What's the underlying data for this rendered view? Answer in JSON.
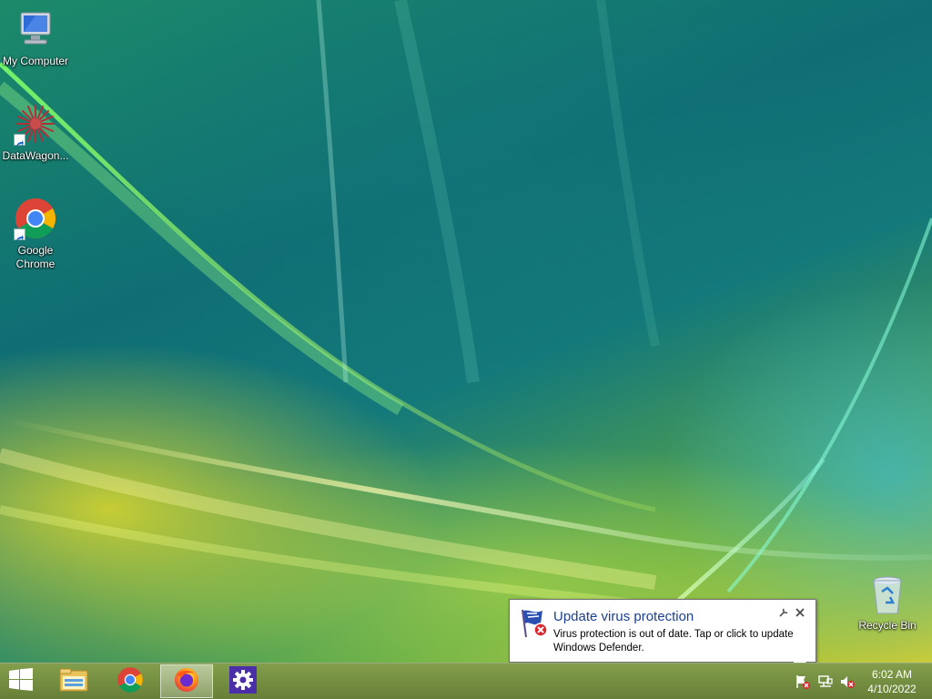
{
  "desktop": {
    "icons": [
      {
        "label": "My Computer",
        "icon": "computer-icon"
      },
      {
        "label": "DataWagon...",
        "icon": "datawagon-icon"
      },
      {
        "label": "Google Chrome",
        "icon": "chrome-icon"
      },
      {
        "label": "Recycle Bin",
        "icon": "recycle-bin-icon"
      }
    ]
  },
  "notification": {
    "title": "Update virus protection",
    "message": "Virus protection is out of date. Tap or click to update Windows Defender.",
    "icon": "defender-flag-icon",
    "options_icon": "wrench-icon",
    "close_icon": "close-icon",
    "title_color": "#1b3f94"
  },
  "taskbar": {
    "start_icon": "windows-logo-icon",
    "apps": [
      {
        "name": "File Explorer",
        "icon": "file-explorer-icon",
        "active": false
      },
      {
        "name": "Google Chrome",
        "icon": "chrome-icon",
        "active": false
      },
      {
        "name": "Firefox",
        "icon": "firefox-icon",
        "active": true
      },
      {
        "name": "Settings",
        "icon": "settings-gear-icon",
        "active": false
      }
    ],
    "tray": {
      "icons": [
        "action-center-alert-icon",
        "network-icon",
        "volume-muted-icon"
      ],
      "time": "6:02 AM",
      "date": "4/10/2022"
    }
  }
}
